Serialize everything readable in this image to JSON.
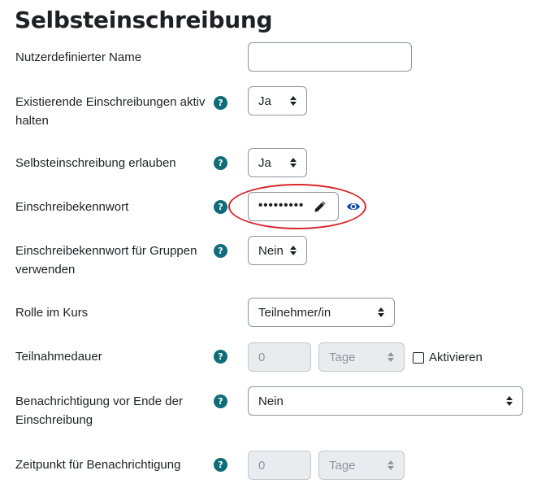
{
  "page": {
    "title": "Selbsteinschreibung"
  },
  "fields": {
    "custom_name": {
      "label": "Nutzerdefinierter Name",
      "value": ""
    },
    "keep_active": {
      "label": "Existierende Einschreibungen aktiv halten",
      "value": "Ja"
    },
    "allow_self": {
      "label": "Selbsteinschreibung erlauben",
      "value": "Ja"
    },
    "password": {
      "label": "Einschreibekennwort",
      "value": "•••••••••"
    },
    "group_password": {
      "label": "Einschreibekennwort für Gruppen verwenden",
      "value": "Nein"
    },
    "role": {
      "label": "Rolle im Kurs",
      "value": "Teilnehmer/in"
    },
    "duration": {
      "label": "Teilnahmedauer",
      "value": "0",
      "unit": "Tage",
      "enable_label": "Aktivieren",
      "enabled": false
    },
    "notify_before": {
      "label": "Benachrichtigung vor Ende der Einschreibung",
      "value": "Nein"
    },
    "notify_time": {
      "label": "Zeitpunkt für Benachrichtigung",
      "value": "0",
      "unit": "Tage"
    }
  },
  "icons": {
    "help": "question-circle-icon",
    "edit": "pencil-icon",
    "reveal": "eye-icon"
  },
  "colors": {
    "help": "#0f6d7a",
    "highlight": "#d6262b",
    "eye": "#0f47ad"
  }
}
